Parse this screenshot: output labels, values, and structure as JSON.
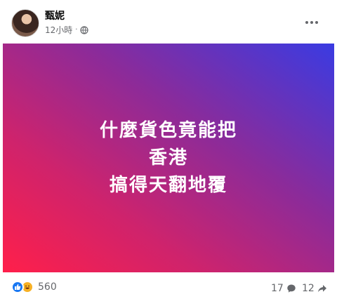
{
  "post": {
    "author": "甄妮",
    "time": "12小時",
    "separator": "·",
    "privacy_icon": "globe-icon",
    "more_icon": "more-options-icon",
    "image_text_lines": [
      "什麼貨色竟能把",
      "香港",
      "搞得天翻地覆"
    ],
    "background_colors": [
      "#ff1f4a",
      "#8b2b9a",
      "#3a3be2"
    ]
  },
  "engagement": {
    "reaction_icons": [
      "like-icon",
      "haha-icon"
    ],
    "reactions_count": "560",
    "comments_count": "17",
    "shares_count": "12"
  }
}
